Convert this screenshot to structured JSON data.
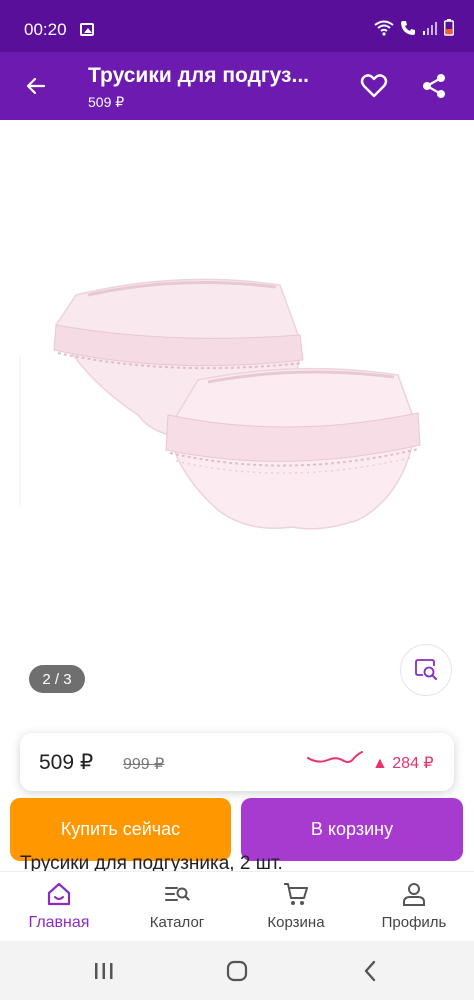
{
  "status_bar": {
    "time": "00:20",
    "icons": [
      "image-icon",
      "wifi-icon",
      "call-icon",
      "signal-icon",
      "battery-icon"
    ]
  },
  "app_bar": {
    "title": "Трусики для подгуз...",
    "price": "509 ₽",
    "icons": [
      "back-arrow-icon",
      "heart-icon",
      "share-icon"
    ]
  },
  "gallery": {
    "counter": "2 / 3",
    "image_description_icon": "zoom-icon"
  },
  "price_card": {
    "current": "509 ₽",
    "old": "999 ₽",
    "diff": "▲ 284 ₽",
    "trend_color": "#e8336b"
  },
  "actions": {
    "buy_now": "Купить сейчас",
    "add_to_cart": "В корзину",
    "buy_now_color": "#ff9800",
    "add_to_cart_color": "#a73bd0"
  },
  "product": {
    "title_peek": "Трусики для подгузника, 2 шт."
  },
  "bottom_nav": {
    "items": [
      {
        "label": "Главная",
        "icon": "home-icon",
        "active": true
      },
      {
        "label": "Каталог",
        "icon": "catalog-search-icon",
        "active": false
      },
      {
        "label": "Корзина",
        "icon": "cart-icon",
        "active": false
      },
      {
        "label": "Профиль",
        "icon": "profile-icon",
        "active": false
      }
    ]
  },
  "system_nav": {
    "icons": [
      "recents-icon",
      "home-circle-icon",
      "back-chevron-icon"
    ]
  },
  "colors": {
    "status_bar": "#5a0f9a",
    "app_bar": "#6d1ab1",
    "accent": "#8a2bc2"
  }
}
